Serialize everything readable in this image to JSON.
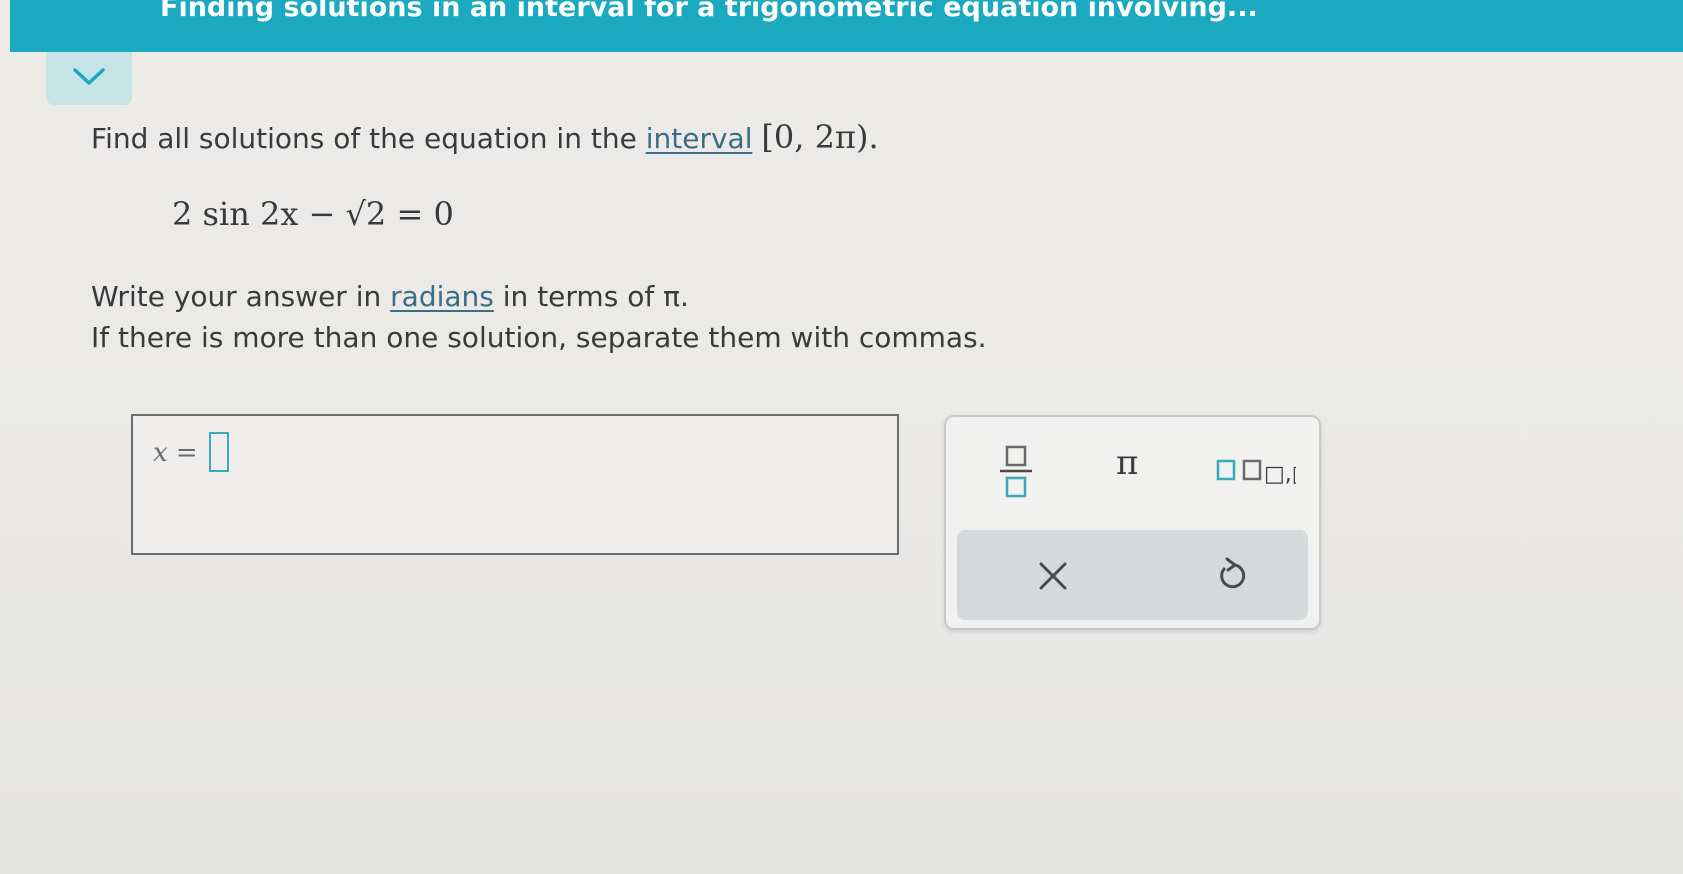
{
  "header": {
    "title": "Finding solutions in an interval for a trigonometric equation involving..."
  },
  "question": {
    "prompt_text": "Find all solutions of the equation in the",
    "interval_link": "interval",
    "interval_math": "[0, 2π).",
    "equation": "2 sin 2x − √2 = 0",
    "instruction_prefix": "Write your answer in",
    "radians_link": "radians",
    "instruction_suffix": "in terms of π.",
    "instruction_2": "If there is more than one solution, separate them with commas."
  },
  "answer": {
    "label": "x =",
    "value": ""
  },
  "toolbox": {
    "pi_label": "π",
    "list_label": "□,□,..."
  },
  "colors": {
    "header": "#1ba9bf",
    "collapse_tab": "#c6e3e6",
    "link": "#3a6e84",
    "input_border": "#3aa8be",
    "action_bar": "#d6d9db"
  },
  "icons": {
    "collapse": "chevron-down-icon",
    "fraction": "fraction-icon",
    "clear": "close-icon",
    "undo": "undo-icon"
  }
}
